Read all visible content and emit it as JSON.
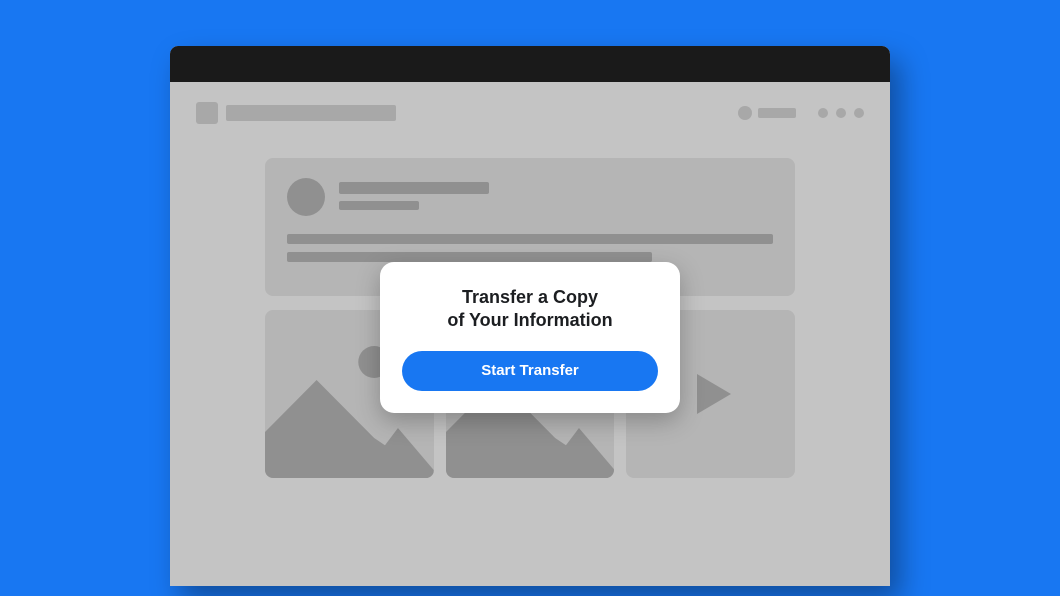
{
  "modal": {
    "title_line1": "Transfer a Copy",
    "title_line2": "of Your Information",
    "cta_label": "Start Transfer"
  },
  "colors": {
    "page_bg": "#1877F2",
    "window_bg": "#C4C4C4",
    "titlebar_bg": "#1A1A1A",
    "placeholder": "#A8A8A8",
    "card_bg": "#B5B5B5",
    "card_fg": "#909090",
    "modal_bg": "#FFFFFF",
    "text": "#1C1E21",
    "button_bg": "#1877F2",
    "button_text": "#FFFFFF"
  }
}
